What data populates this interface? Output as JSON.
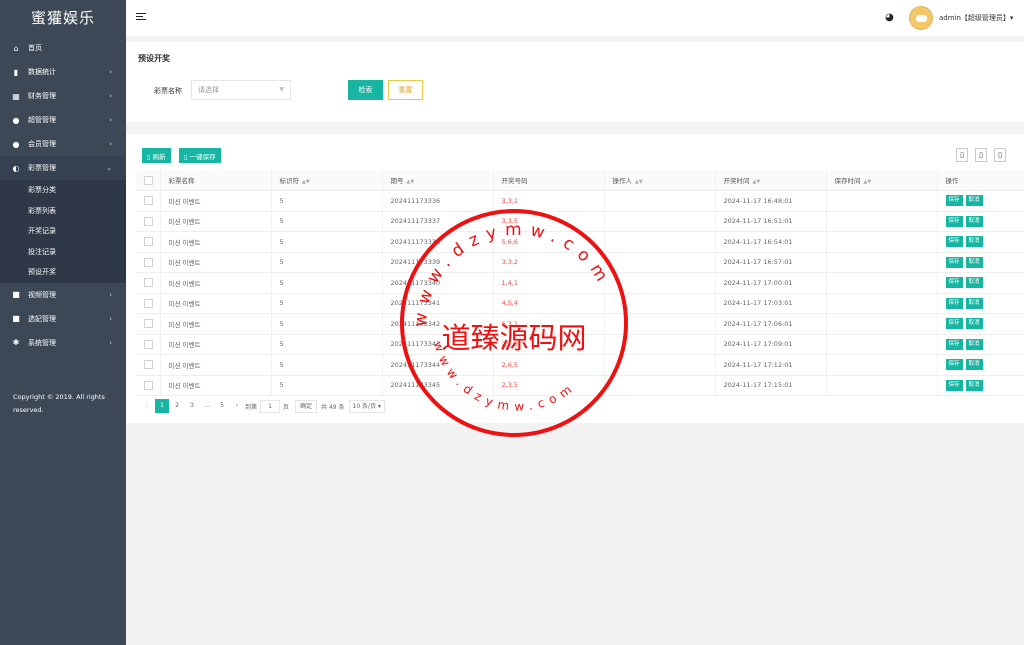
{
  "app": {
    "title": "蜜獾娱乐"
  },
  "sidebar": {
    "items": [
      {
        "label": "首页",
        "icon": "home-icon",
        "glyph": "⌂",
        "arrow": ""
      },
      {
        "label": "数据统计",
        "icon": "bar-chart-icon",
        "glyph": "▮",
        "arrow": "›"
      },
      {
        "label": "财务管理",
        "icon": "bank-icon",
        "glyph": "▦",
        "arrow": "›"
      },
      {
        "label": "超管管理",
        "icon": "user-icon",
        "glyph": "●",
        "arrow": "›"
      },
      {
        "label": "会员管理",
        "icon": "users-icon",
        "glyph": "●",
        "arrow": "›"
      },
      {
        "label": "彩票管理",
        "icon": "gamepad-icon",
        "glyph": "◐",
        "arrow": "⌄"
      }
    ],
    "sub_items": [
      "彩票分类",
      "彩票列表",
      "开奖记录",
      "投注记录",
      "预设开奖"
    ],
    "items_after": [
      {
        "label": "视频管理",
        "icon": "video-icon",
        "glyph": "■",
        "arrow": "›"
      },
      {
        "label": "选妃管理",
        "icon": "video-icon",
        "glyph": "■",
        "arrow": "›"
      },
      {
        "label": "系统管理",
        "icon": "gear-icon",
        "glyph": "✱",
        "arrow": "›"
      }
    ],
    "copyright": "Copyright © 2019. All rights reserved."
  },
  "header": {
    "user": "admin【超级管理员】▾"
  },
  "search": {
    "title": "预设开奖",
    "field_label": "彩票名称",
    "placeholder": "请选择",
    "search_label": "检索",
    "reset_label": "重置"
  },
  "toolbar": {
    "refresh_label": "刷新",
    "save_all_label": "一键保存"
  },
  "table": {
    "headers": [
      "彩票名称",
      "标识符",
      "期号",
      "开奖号码",
      "操作人",
      "开奖时间",
      "保存时间",
      "操作"
    ],
    "sortable": [
      false,
      true,
      true,
      false,
      true,
      true,
      true,
      false
    ],
    "save_label": "保存",
    "cancel_label": "取消",
    "rows": [
      {
        "name": "미션 이벤트",
        "key": "5",
        "issue": "202411173336",
        "nums": "3,3,1",
        "op": "",
        "time": "2024-11-17 16:48:01",
        "saved": ""
      },
      {
        "name": "미션 이벤트",
        "key": "5",
        "issue": "202411173337",
        "nums": "3,3,5",
        "op": "",
        "time": "2024-11-17 16:51:01",
        "saved": ""
      },
      {
        "name": "미션 이벤트",
        "key": "5",
        "issue": "202411173338",
        "nums": "5,6,6",
        "op": "",
        "time": "2024-11-17 16:54:01",
        "saved": ""
      },
      {
        "name": "미션 이벤트",
        "key": "5",
        "issue": "202411173339",
        "nums": "3,3,2",
        "op": "",
        "time": "2024-11-17 16:57:01",
        "saved": ""
      },
      {
        "name": "미션 이벤트",
        "key": "5",
        "issue": "202411173340",
        "nums": "1,4,1",
        "op": "",
        "time": "2024-11-17 17:00:01",
        "saved": ""
      },
      {
        "name": "미션 이벤트",
        "key": "5",
        "issue": "202411173341",
        "nums": "4,5,4",
        "op": "",
        "time": "2024-11-17 17:03:01",
        "saved": ""
      },
      {
        "name": "미션 이벤트",
        "key": "5",
        "issue": "202411173342",
        "nums": "6,3,1",
        "op": "",
        "time": "2024-11-17 17:06:01",
        "saved": ""
      },
      {
        "name": "미션 이벤트",
        "key": "5",
        "issue": "202411173343",
        "nums": "2,1,3",
        "op": "",
        "time": "2024-11-17 17:09:01",
        "saved": ""
      },
      {
        "name": "미션 이벤트",
        "key": "5",
        "issue": "202411173344",
        "nums": "2,6,5",
        "op": "",
        "time": "2024-11-17 17:12:01",
        "saved": ""
      },
      {
        "name": "미션 이벤트",
        "key": "5",
        "issue": "202411173345",
        "nums": "2,3,5",
        "op": "",
        "time": "2024-11-17 17:15:01",
        "saved": ""
      }
    ]
  },
  "pager": {
    "pages": [
      "1",
      "2",
      "3",
      "...",
      "5"
    ],
    "goto": "到第",
    "page_value": "1",
    "page_unit": "页",
    "confirm": "确定",
    "total": "共 49 条",
    "per_page": "10 条/页"
  },
  "watermark": {
    "center": "道臻源码网",
    "arc_top": "www.dzymw.com",
    "arc_bottom": "www.dzymw.com",
    "color": "#e11111"
  }
}
